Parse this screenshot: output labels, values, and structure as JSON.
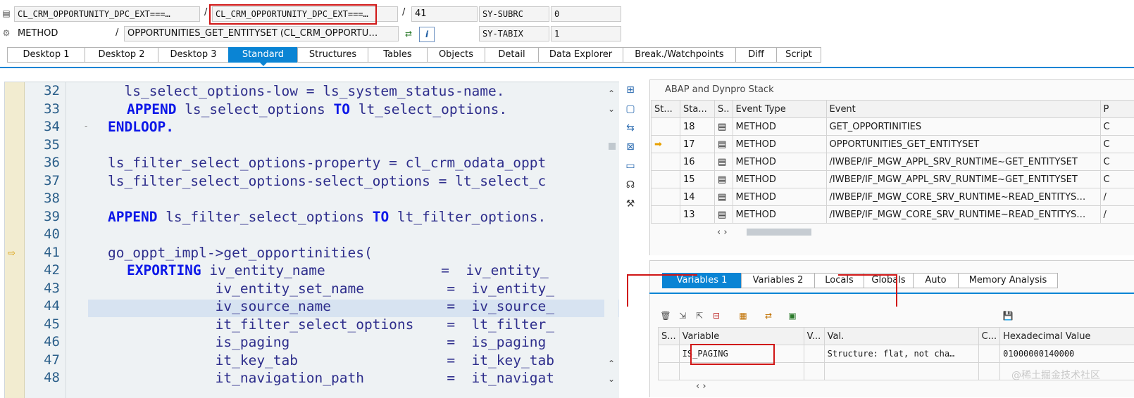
{
  "header": {
    "row1": {
      "program": "CL_CRM_OPPORTUNITY_DPC_EXT===…",
      "include": "CL_CRM_OPPORTUNITY_DPC_EXT===…",
      "sep1": "/",
      "sep2": "/",
      "line": "41",
      "sysvar_name": "SY-SUBRC",
      "sysvar_value": "0"
    },
    "row2": {
      "event_type": "METHOD",
      "sep": "/",
      "event": "OPPORTUNITIES_GET_ENTITYSET (CL_CRM_OPPORTU…",
      "sysvar_name": "SY-TABIX",
      "sysvar_value": "1"
    }
  },
  "tabs": [
    "Desktop 1",
    "Desktop 2",
    "Desktop 3",
    "Standard",
    "Structures",
    "Tables",
    "Objects",
    "Detail",
    "Data Explorer",
    "Break./Watchpoints",
    "Diff",
    "Script"
  ],
  "active_tab": "Standard",
  "code": {
    "lines": [
      {
        "n": "32",
        "text": "  ls_select_options-low = ls_system_status-name."
      },
      {
        "n": "33",
        "kw1": "APPEND",
        "mid": " ls_select_options ",
        "kw2": "TO",
        "rest": " lt_select_options.",
        "indent": "  "
      },
      {
        "n": "34",
        "kw1": "ENDLOOP",
        "rest": "."
      },
      {
        "n": "35",
        "text": ""
      },
      {
        "n": "36",
        "text": "ls_filter_select_options-property = cl_crm_odata_oppt"
      },
      {
        "n": "37",
        "text": "ls_filter_select_options-select_options = lt_select_c"
      },
      {
        "n": "38",
        "text": ""
      },
      {
        "n": "39",
        "kw1": "APPEND",
        "mid": " ls_filter_select_options ",
        "kw2": "TO",
        "rest": " lt_filter_options."
      },
      {
        "n": "40",
        "text": ""
      },
      {
        "n": "41",
        "text": "go_oppt_impl->get_opportinities("
      },
      {
        "n": "42",
        "kw1": "EXPORTING",
        "mid": " iv_entity_name",
        "rest": "              =  iv_entity_",
        "indent": "  "
      },
      {
        "n": "43",
        "text": "             iv_entity_set_name          =  iv_entity_"
      },
      {
        "n": "44",
        "text": "             iv_source_name              =  iv_source_"
      },
      {
        "n": "45",
        "text": "             it_filter_select_options    =  lt_filter_"
      },
      {
        "n": "46",
        "text": "             is_paging                   =  is_paging"
      },
      {
        "n": "47",
        "text": "             it_key_tab                  =  it_key_tab"
      },
      {
        "n": "48",
        "text": "             it_navigation_path          =  it_navigat"
      }
    ]
  },
  "stack": {
    "title": "ABAP and Dynpro Stack",
    "columns": [
      "St...",
      "Sta...",
      "S..",
      "Event Type",
      "Event",
      "P"
    ],
    "rows": [
      {
        "level": "18",
        "type": "METHOD",
        "event": "GET_OPPORTINITIES",
        "p": "C"
      },
      {
        "level": "17",
        "type": "METHOD",
        "event": "OPPORTUNITIES_GET_ENTITYSET",
        "p": "C"
      },
      {
        "level": "16",
        "type": "METHOD",
        "event": "/IWBEP/IF_MGW_APPL_SRV_RUNTIME~GET_ENTITYSET",
        "p": "C"
      },
      {
        "level": "15",
        "type": "METHOD",
        "event": "/IWBEP/IF_MGW_APPL_SRV_RUNTIME~GET_ENTITYSET",
        "p": "C"
      },
      {
        "level": "14",
        "type": "METHOD",
        "event": "/IWBEP/IF_MGW_CORE_SRV_RUNTIME~READ_ENTITYS…",
        "p": "/"
      },
      {
        "level": "13",
        "type": "METHOD",
        "event": "/IWBEP/IF_MGW_CORE_SRV_RUNTIME~READ_ENTITYS…",
        "p": "/"
      }
    ]
  },
  "vartabs": [
    "Variables 1",
    "Variables 2",
    "Locals",
    "Globals",
    "Auto",
    "Memory Analysis"
  ],
  "active_vartab": "Variables 1",
  "vars": {
    "columns": [
      "S...",
      "Variable",
      "V...",
      "Val.",
      "C...",
      "Hexadecimal Value"
    ],
    "rows": [
      {
        "name": "IS_PAGING",
        "value": "Structure: flat, not cha…",
        "hex": "01000000140000"
      }
    ]
  },
  "watermark": "@稀土掘金技术社区",
  "colors": {
    "accent": "#0a84d4",
    "highlight_red": "#d01616",
    "keyword": "#0c17e8",
    "code_text": "#2e2e8c"
  }
}
